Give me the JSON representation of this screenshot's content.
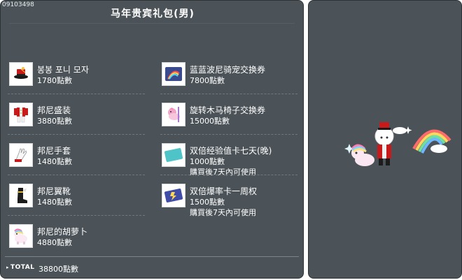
{
  "window": {
    "code": "09103498",
    "title": "马年贵宾礼包(男)"
  },
  "items_left": [
    {
      "name": "봉봉 포니 모자",
      "price": "1780點數",
      "icon": "red-fez-hat-icon"
    },
    {
      "name": "邦尼盛装",
      "price": "3880點數",
      "icon": "red-suit-outfit-icon"
    },
    {
      "name": "邦尼手套",
      "price": "1480點數",
      "icon": "white-glove-icon"
    },
    {
      "name": "邦尼翼靴",
      "price": "1480點數",
      "icon": "black-winged-boot-icon"
    },
    {
      "name": "邦尼的胡萝卜",
      "price": "4880點數",
      "icon": "rainbow-pony-icon"
    }
  ],
  "items_right": [
    {
      "name": "蓝蓝波尼骑宠交换券",
      "price": "7800點數",
      "note": "",
      "icon": "rainbow-coupon-icon"
    },
    {
      "name": "旋转木马椅子交换券",
      "price": "15000點數",
      "note": "",
      "icon": "carousel-chair-icon"
    },
    {
      "name": "双倍经验值卡七天(晚)",
      "price": "1000點數",
      "note": "購買後7天內可使用",
      "icon": "moon-card-icon"
    },
    {
      "name": "双倍爆率卡一周权",
      "price": "1500點數",
      "note": "購買後7天內可使用",
      "icon": "drop-rate-card-icon"
    }
  ],
  "total": {
    "label": "TOTAL",
    "value": "38800點數"
  },
  "preview": {
    "icon": "character-preview-with-rainbow-icon"
  }
}
